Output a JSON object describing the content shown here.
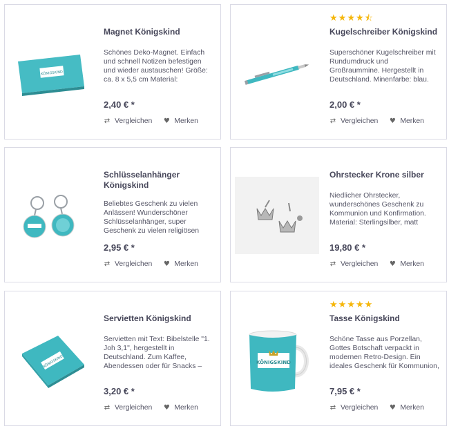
{
  "products": [
    {
      "title": "Magnet Königskind",
      "desc": "Schönes Deko-Magnet. Einfach und schnell Notizen befestigen und wieder austauschen! Größe: ca. 8 x 5,5 cm Material:",
      "price": "2,40 € *",
      "stars": 0,
      "image_icon": "magnet-image"
    },
    {
      "title": "Kugelschreiber Königskind",
      "desc": "Superschöner Kugelschreiber mit Rundumdruck und Großraummine. Hergestellt in Deutschland. Minenfarbe: blau.",
      "price": "2,00 € *",
      "stars": 4.5,
      "image_icon": "pen-image"
    },
    {
      "title": "Schlüsselanhänger Königskind",
      "desc": "Beliebtes Geschenk zu vielen Anlässen! Wunderschöner Schlüsselanhänger, super Geschenk zu vielen religiösen",
      "price": "2,95 € *",
      "stars": 0,
      "image_icon": "keychain-image"
    },
    {
      "title": "Ohrstecker Krone silber",
      "desc": "Niedlicher Ohrstecker, wunderschönes Geschenk zu Kommunion und Konfirmation. Material: Sterlingsilber, matt",
      "price": "19,80 € *",
      "stars": 0,
      "image_icon": "earring-image"
    },
    {
      "title": "Servietten Königskind",
      "desc": "Servietten mit Text: Bibelstelle \"1. Joh 3,1\", hergestellt in Deutschland. Zum Kaffee, Abendessen oder für Snacks –",
      "price": "3,20 € *",
      "stars": 0,
      "image_icon": "napkin-image"
    },
    {
      "title": "Tasse Königskind",
      "desc": "Schöne Tasse aus Porzellan, Gottes Botschaft verpackt in modernen Retro-Design. Ein ideales Geschenk für Kommunion,",
      "price": "7,95 € *",
      "stars": 5,
      "image_icon": "mug-image"
    }
  ],
  "labels": {
    "compare": "Vergleichen",
    "remember": "Merken"
  },
  "product_image_text": "KÖNIGSKIND",
  "colors": {
    "accent_teal": "#3fb8c0",
    "star": "#f5b60a",
    "border": "#dadae5"
  }
}
